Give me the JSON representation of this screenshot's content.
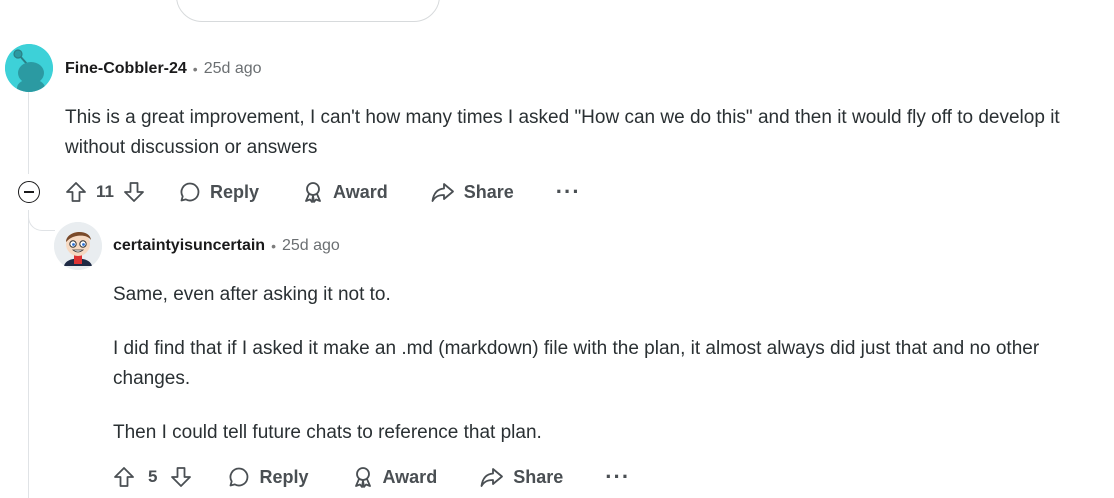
{
  "comments": [
    {
      "author": "Fine-Cobbler-24",
      "separator": "•",
      "time": "25d ago",
      "paragraphs": [
        "This is a great improvement, I can't how many times I asked \"How can we do this\" and then it would fly off to develop it without discussion or answers"
      ],
      "votes": "11",
      "actions": {
        "reply": "Reply",
        "award": "Award",
        "share": "Share",
        "more": "···"
      },
      "avatar_icon": "snoo-avatar-icon",
      "avatar_color": "#3dd1d8"
    },
    {
      "author": "certaintyisuncertain",
      "separator": "•",
      "time": "25d ago",
      "paragraphs": [
        "Same, even after asking it not to.",
        "I did find that if I asked it make an .md (markdown) file with the plan, it almost always did just that and no other changes.",
        "Then I could tell future chats to reference that plan."
      ],
      "votes": "5",
      "actions": {
        "reply": "Reply",
        "award": "Award",
        "share": "Share",
        "more": "···"
      },
      "avatar_icon": "cartoon-avatar-icon"
    }
  ]
}
